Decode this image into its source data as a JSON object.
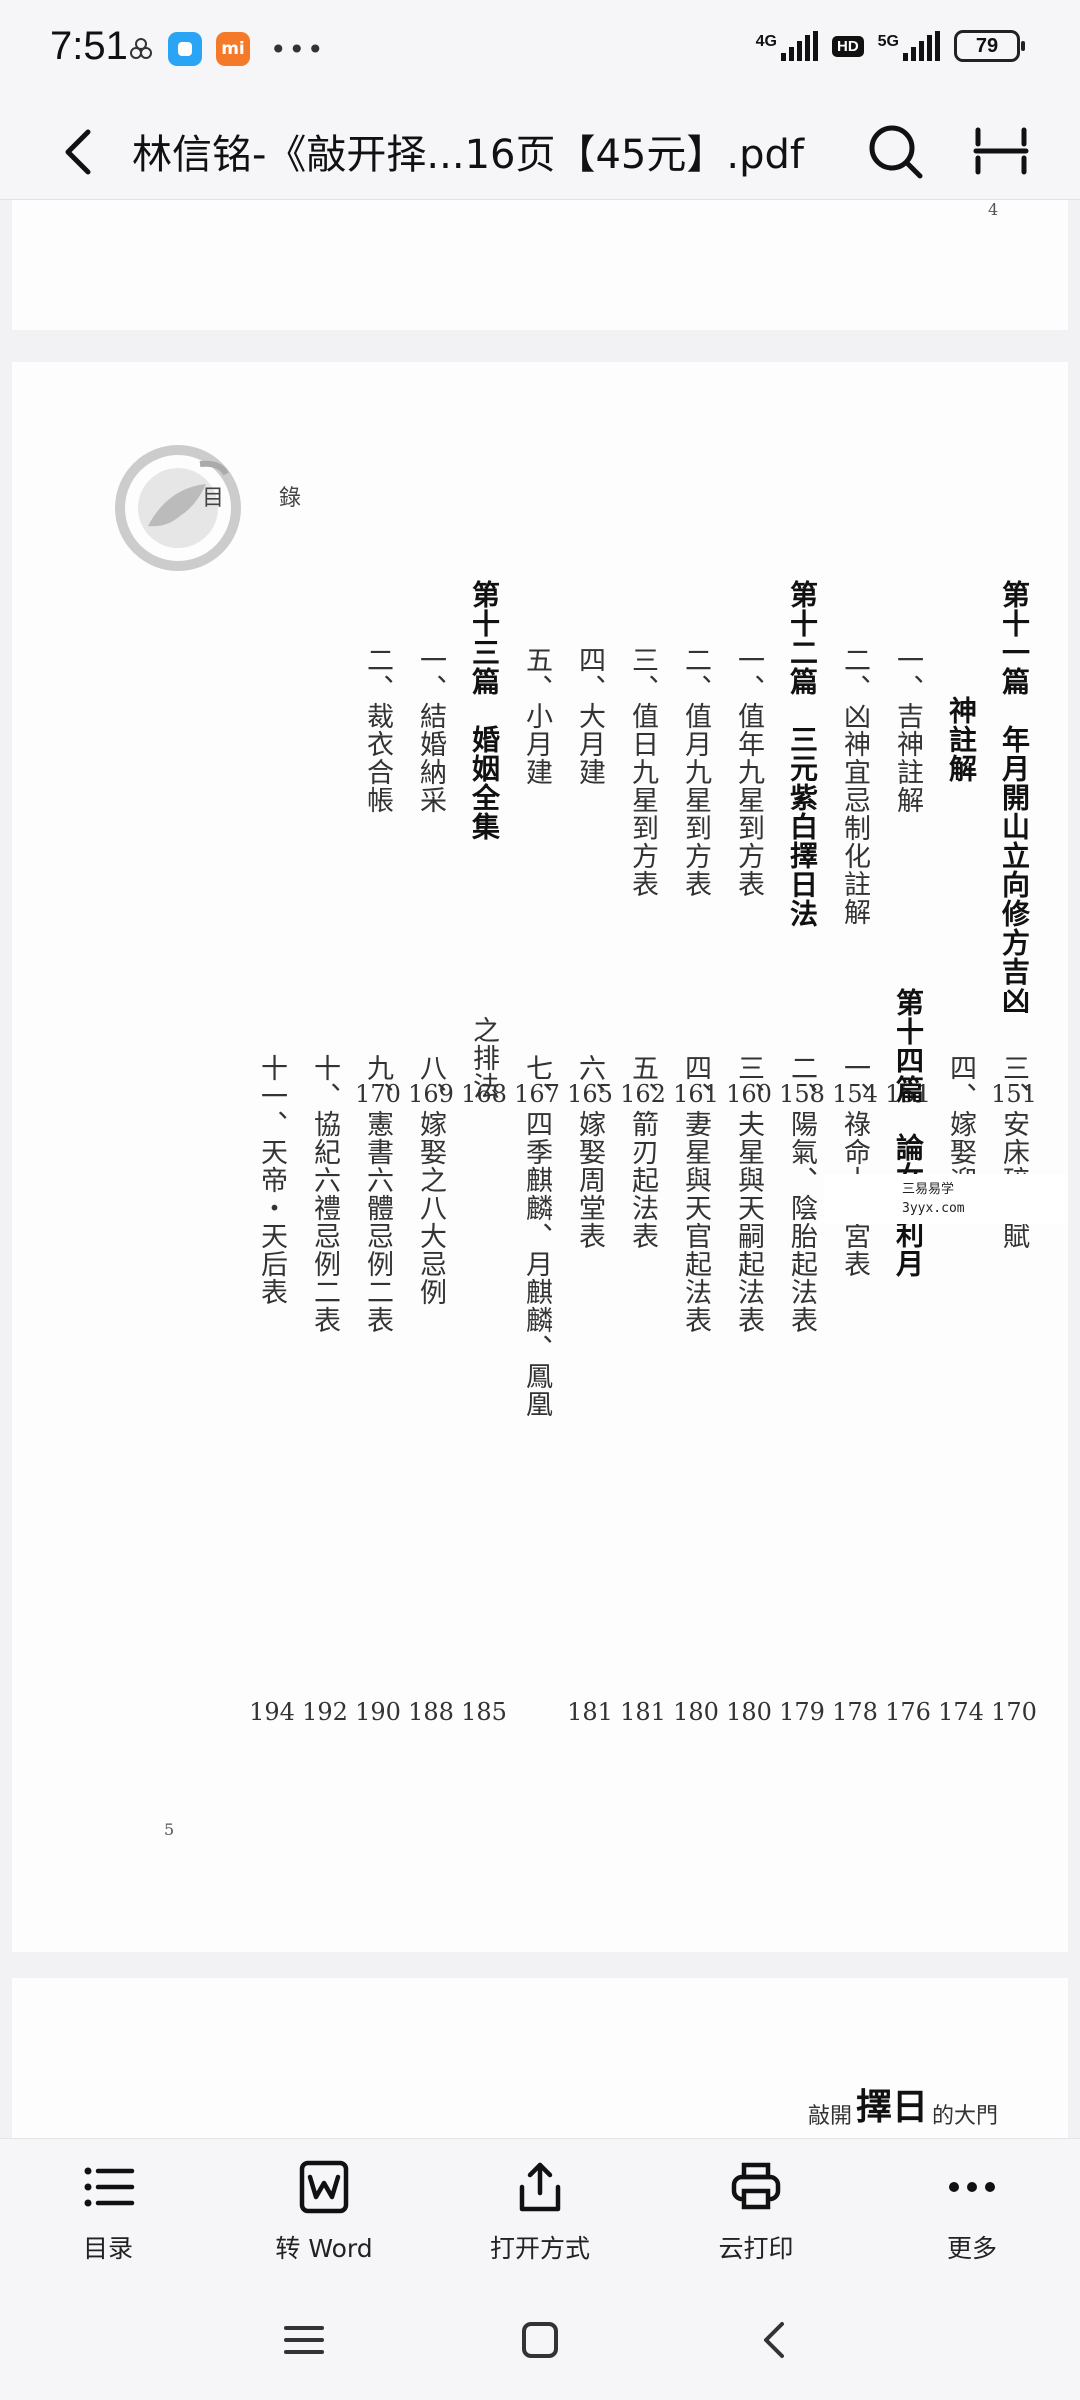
{
  "status_bar": {
    "time": "7:51",
    "app_icons": [
      "network-share-icon",
      "app-blue-icon",
      "mi-app-icon"
    ],
    "mi_label": "mi",
    "more_dots": "•••",
    "signal1_label": "4G",
    "hd_label": "HD",
    "signal2_label": "5G",
    "battery": "79"
  },
  "title_bar": {
    "title": "林信铭-《敲开择...16页【45元】.pdf",
    "back_icon": "chevron-left-icon",
    "search_icon": "search-icon",
    "mode_icon": "reading-mode-icon"
  },
  "page_top": {
    "page_number": "4"
  },
  "toc_page": {
    "header": "目 錄",
    "page_number": "5",
    "watermark": [
      "三易易学",
      "3yyx.com"
    ],
    "upper_section": [
      {
        "text": "第十一篇　年月開山立向修方吉凶",
        "type": "chapter",
        "page": "151"
      },
      {
        "text": "神註解",
        "type": "chapter-cont",
        "page": ""
      },
      {
        "text": "一、吉神註解",
        "type": "item",
        "page": "151"
      },
      {
        "text": "二、凶神宜忌制化註解",
        "type": "item",
        "page": "154"
      },
      {
        "text": "第十二篇　三元紫白擇日法",
        "type": "chapter",
        "page": "158"
      },
      {
        "text": "一、值年九星到方表",
        "type": "item",
        "page": "160"
      },
      {
        "text": "二、值月九星到方表",
        "type": "item",
        "page": "161"
      },
      {
        "text": "三、值日九星到方表",
        "type": "item",
        "page": "162"
      },
      {
        "text": "四、大月建",
        "type": "item",
        "page": "165"
      },
      {
        "text": "五、小月建",
        "type": "item",
        "page": "167"
      },
      {
        "text": "第十三篇　婚姻全集",
        "type": "chapter",
        "page": "168"
      },
      {
        "text": "一、結婚納采",
        "type": "item",
        "page": "169"
      },
      {
        "text": "二、裁衣合帳",
        "type": "item",
        "page": "170"
      }
    ],
    "lower_section": [
      {
        "text": "三、安床碎金賦",
        "type": "item",
        "page": "170"
      },
      {
        "text": "四、嫁娶迎親",
        "type": "item",
        "page": "174"
      },
      {
        "text": "第十四篇　論女命利月",
        "type": "chapter",
        "page": "176"
      },
      {
        "text": "一、祿命十二宮表",
        "type": "item",
        "page": "178"
      },
      {
        "text": "二、陽氣、陰胎起法表",
        "type": "item",
        "page": "179"
      },
      {
        "text": "三、夫星與天嗣起法表",
        "type": "item",
        "page": "180"
      },
      {
        "text": "四、妻星與天官起法表",
        "type": "item",
        "page": "180"
      },
      {
        "text": "五、箭刃起法表",
        "type": "item",
        "page": "181"
      },
      {
        "text": "六、嫁娶周堂表",
        "type": "item",
        "page": "181"
      },
      {
        "text": "七、四季麒麟、月麒麟、鳳凰",
        "type": "item",
        "page": ""
      },
      {
        "text": "之排法",
        "type": "item-cont",
        "page": "185"
      },
      {
        "text": "八、嫁娶之八大忌例",
        "type": "item",
        "page": "188"
      },
      {
        "text": "九、憲書六體忌例二表",
        "type": "item",
        "page": "190"
      },
      {
        "text": "十、協紀六禮忌例二表",
        "type": "item",
        "page": "192"
      },
      {
        "text": "十一、天帝・天后表",
        "type": "item",
        "page": "194"
      }
    ]
  },
  "page_bottom": {
    "banner_pre": "敲開",
    "banner_big": "擇日",
    "banner_post": "的大門"
  },
  "toolbar": {
    "items": [
      {
        "label": "目录",
        "icon": "list-icon"
      },
      {
        "label": "转 Word",
        "icon": "convert-word-icon"
      },
      {
        "label": "打开方式",
        "icon": "share-icon"
      },
      {
        "label": "云打印",
        "icon": "printer-icon"
      },
      {
        "label": "更多",
        "icon": "more-icon"
      }
    ]
  },
  "navbar": {
    "menu_icon": "menu-icon",
    "home_icon": "home-icon",
    "back_icon": "back-icon"
  }
}
